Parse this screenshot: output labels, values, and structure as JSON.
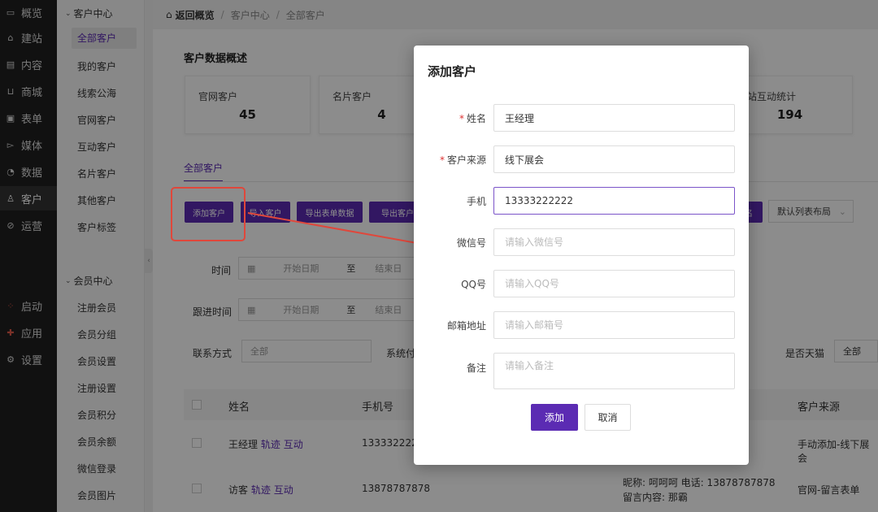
{
  "nav": {
    "items": [
      {
        "label": "概览",
        "icon": "monitor-icon"
      },
      {
        "label": "建站",
        "icon": "home-icon"
      },
      {
        "label": "内容",
        "icon": "document-icon"
      },
      {
        "label": "商城",
        "icon": "cart-icon"
      },
      {
        "label": "表单",
        "icon": "form-icon"
      },
      {
        "label": "媒体",
        "icon": "video-icon"
      },
      {
        "label": "数据",
        "icon": "pie-chart-icon"
      },
      {
        "label": "客户",
        "icon": "user-icon"
      },
      {
        "label": "运营",
        "icon": "tag-icon"
      },
      {
        "label": "启动",
        "icon": "launch-icon"
      },
      {
        "label": "应用",
        "icon": "apps-icon"
      },
      {
        "label": "设置",
        "icon": "gear-icon"
      }
    ]
  },
  "subnav": {
    "group1": "客户中心",
    "group1_items": [
      "全部客户",
      "我的客户",
      "线索公海",
      "官网客户",
      "互动客户",
      "名片客户",
      "其他客户",
      "客户标签"
    ],
    "group2": "会员中心",
    "group2_items": [
      "注册会员",
      "会员分组",
      "会员设置",
      "注册设置",
      "会员积分",
      "会员余额",
      "微信登录",
      "会员图片"
    ]
  },
  "breadcrumb": {
    "back": "返回概览",
    "level1": "客户中心",
    "level2": "全部客户"
  },
  "overview": {
    "title": "客户数据概述",
    "stats": [
      {
        "label": "官网客户",
        "value": "45"
      },
      {
        "label": "名片客户",
        "value": "4"
      },
      {
        "label": "站互动统计",
        "value": "194"
      }
    ]
  },
  "tab": "全部客户",
  "toolbar": {
    "buttons": [
      "添加客户",
      "导入客户",
      "导出表单数据",
      "导出客户数"
    ],
    "right_btn": "名",
    "layout_select": "默认列表布局"
  },
  "filters": {
    "time_label": "时间",
    "follow_label": "跟进时间",
    "contact_label": "联系方式",
    "system_label": "系统付",
    "tmall_label": "是否天猫",
    "start_placeholder": "开始日期",
    "to": "至",
    "end_placeholder": "结束日",
    "all": "全部"
  },
  "table": {
    "headers": [
      "姓名",
      "手机号",
      "客户来源"
    ],
    "rows": [
      {
        "name": "王经理",
        "link1": "轨迹",
        "link2": "互动",
        "phone": "1333322222",
        "extra": "",
        "source": "手动添加-线下展会"
      },
      {
        "name": "访客",
        "link1": "轨迹",
        "link2": "互动",
        "phone": "13878787878",
        "extra": "昵称: 呵呵呵 电话: 13878787878 留言内容: 那霸",
        "source": "官网-留言表单"
      }
    ]
  },
  "modal": {
    "title": "添加客户",
    "fields": [
      {
        "label": "姓名",
        "required": true,
        "value": "王经理",
        "placeholder": ""
      },
      {
        "label": "客户来源",
        "required": true,
        "value": "线下展会",
        "placeholder": ""
      },
      {
        "label": "手机",
        "required": false,
        "value": "13333222222",
        "placeholder": ""
      },
      {
        "label": "微信号",
        "required": false,
        "value": "",
        "placeholder": "请输入微信号"
      },
      {
        "label": "QQ号",
        "required": false,
        "value": "",
        "placeholder": "请输入QQ号"
      },
      {
        "label": "邮箱地址",
        "required": false,
        "value": "",
        "placeholder": "请输入邮箱号"
      },
      {
        "label": "备注",
        "required": false,
        "value": "",
        "placeholder": "请输入备注"
      }
    ],
    "submit": "添加",
    "cancel": "取消"
  },
  "colors": {
    "accent": "#5b2bb3",
    "annotation": "#e0473b"
  }
}
